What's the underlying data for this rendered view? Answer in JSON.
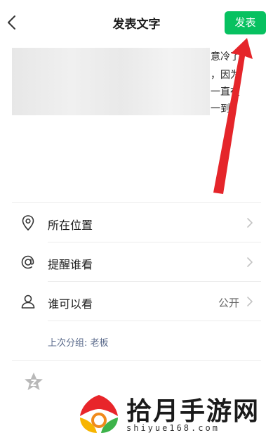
{
  "header": {
    "title": "发表文字",
    "publish_label": "发表"
  },
  "post": {
    "text_lines": [
      "意冷了",
      "，因为",
      "一直在",
      "一到"
    ]
  },
  "options": [
    {
      "label": "所在位置",
      "value": "",
      "icon": "location-pin-icon"
    },
    {
      "label": "提醒谁看",
      "value": "",
      "icon": "at-sign-icon"
    },
    {
      "label": "谁可以看",
      "value": "公开",
      "icon": "person-icon"
    }
  ],
  "group_hint": "上次分组: 老板",
  "watermark": {
    "title": "拾月手游网",
    "url": "shiyue168.com"
  },
  "colors": {
    "accent": "#07c160",
    "arrow": "#e5252a",
    "hint": "#5b6b8c"
  }
}
